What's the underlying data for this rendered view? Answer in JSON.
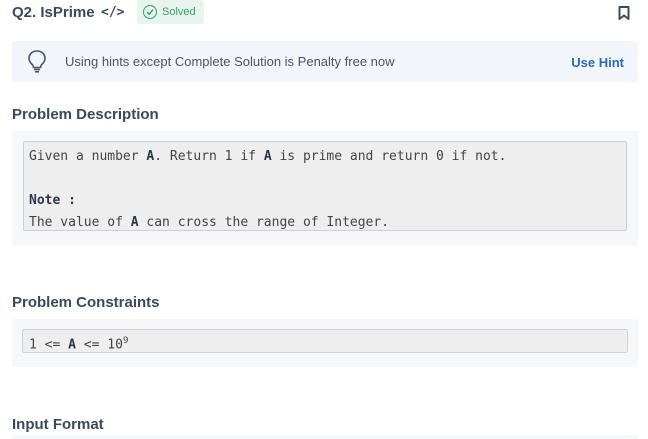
{
  "header": {
    "title": "Q2. IsPrime",
    "code_symbol": "</>",
    "status": "Solved",
    "icons": [
      "code-icon",
      "check-circle-icon",
      "bookmark-icon"
    ]
  },
  "hint": {
    "icon": "lightbulb-icon",
    "text": "Using hints except Complete Solution is Penalty free now",
    "button": "Use Hint"
  },
  "description": {
    "title": "Problem Description",
    "line1": {
      "a": "Given a number ",
      "b": "A",
      "c": ". Return 1 if ",
      "d": "A",
      "e": " is prime and return 0 if not."
    },
    "note_label": "Note :",
    "note_line": {
      "a": "The value of ",
      "b": "A",
      "c": " can cross the range of Integer."
    }
  },
  "constraints": {
    "title": "Problem Constraints",
    "a": "1 <= ",
    "b": "A",
    "c": " <= 10",
    "exp": "9"
  },
  "input_format": {
    "title": "Input Format"
  },
  "colors": {
    "accent": "#2b6cb0",
    "success": "#38a169",
    "heading": "#3a4a5c"
  }
}
